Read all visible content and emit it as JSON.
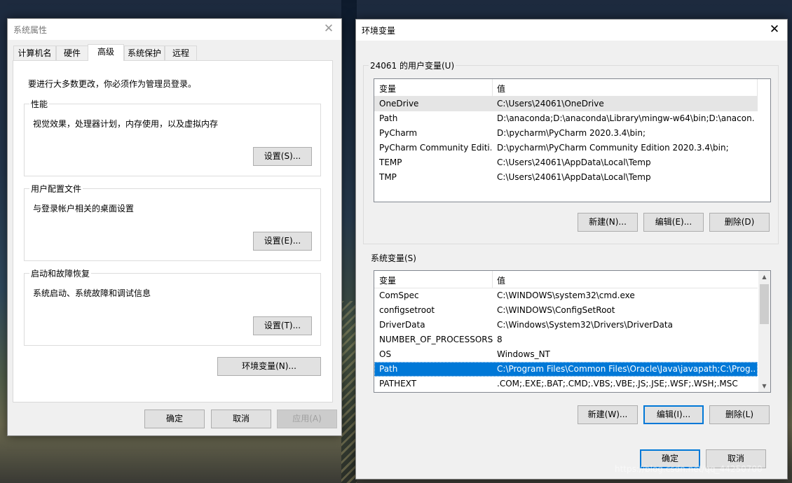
{
  "left": {
    "title": "系统属性",
    "tabs": [
      "计算机名",
      "硬件",
      "高级",
      "系统保护",
      "远程"
    ],
    "admin_note": "要进行大多数更改，你必须作为管理员登录。",
    "perf": {
      "title": "性能",
      "desc": "视觉效果，处理器计划，内存使用，以及虚拟内存",
      "btn": "设置(S)..."
    },
    "profile": {
      "title": "用户配置文件",
      "desc": "与登录帐户相关的桌面设置",
      "btn": "设置(E)..."
    },
    "startup": {
      "title": "启动和故障恢复",
      "desc": "系统启动、系统故障和调试信息",
      "btn": "设置(T)..."
    },
    "env_btn": "环境变量(N)...",
    "ok": "确定",
    "cancel": "取消",
    "apply": "应用(A)"
  },
  "right": {
    "title": "环境变量",
    "user_group": "24061 的用户变量(U)",
    "col_var": "变量",
    "col_val": "值",
    "user_vars": [
      {
        "name": "OneDrive",
        "value": "C:\\Users\\24061\\OneDrive"
      },
      {
        "name": "Path",
        "value": "D:\\anaconda;D:\\anaconda\\Library\\mingw-w64\\bin;D:\\anacon..."
      },
      {
        "name": "PyCharm",
        "value": "D:\\pycharm\\PyCharm 2020.3.4\\bin;"
      },
      {
        "name": "PyCharm Community Editi...",
        "value": "D:\\pycharm\\PyCharm Community Edition 2020.3.4\\bin;"
      },
      {
        "name": "TEMP",
        "value": "C:\\Users\\24061\\AppData\\Local\\Temp"
      },
      {
        "name": "TMP",
        "value": "C:\\Users\\24061\\AppData\\Local\\Temp"
      }
    ],
    "user_new": "新建(N)...",
    "user_edit": "编辑(E)...",
    "user_delete": "删除(D)",
    "sys_group": "系统变量(S)",
    "sys_vars": [
      {
        "name": "ComSpec",
        "value": "C:\\WINDOWS\\system32\\cmd.exe"
      },
      {
        "name": "configsetroot",
        "value": "C:\\WINDOWS\\ConfigSetRoot"
      },
      {
        "name": "DriverData",
        "value": "C:\\Windows\\System32\\Drivers\\DriverData"
      },
      {
        "name": "NUMBER_OF_PROCESSORS",
        "value": "8"
      },
      {
        "name": "OS",
        "value": "Windows_NT"
      },
      {
        "name": "Path",
        "value": "C:\\Program Files\\Common Files\\Oracle\\Java\\javapath;C:\\Prog..."
      },
      {
        "name": "PATHEXT",
        "value": ".COM;.EXE;.BAT;.CMD;.VBS;.VBE;.JS;.JSE;.WSF;.WSH;.MSC"
      }
    ],
    "sys_new": "新建(W)...",
    "sys_edit": "编辑(I)...",
    "sys_delete": "删除(L)",
    "ok": "确定",
    "cancel": "取消"
  },
  "watermark": "https://blog.csdn.net/qq_44250700"
}
